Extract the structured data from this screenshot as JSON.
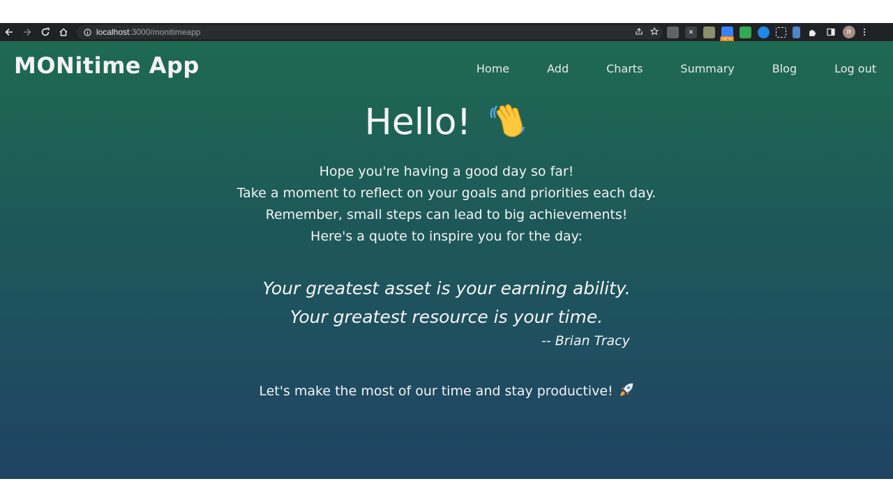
{
  "browser": {
    "url_host": "localhost",
    "url_rest": ":3000/monitimeapp",
    "extensions": [
      "printer-ext",
      "x-ext",
      "photo-ext",
      "calendar-ext",
      "sheet-ext",
      "edge-ext",
      "screenshot-ext",
      "clipboard-ext",
      "puzzle-ext",
      "sidepanel-ext"
    ],
    "new_badge": "NEW",
    "avatar_initial": "R"
  },
  "app": {
    "brand": "MONitime App",
    "nav": [
      "Home",
      "Add",
      "Charts",
      "Summary",
      "Blog",
      "Log out"
    ],
    "greeting": "Hello!",
    "messages": [
      "Hope you're having a good day so far!",
      "Take a moment to reflect on your goals and priorities each day.",
      "Remember, small steps can lead to big achievements!",
      "Here's a quote to inspire you for the day:"
    ],
    "quote_lines": [
      "Your greatest asset is your earning ability.",
      "Your greatest resource is your time."
    ],
    "author": "-- Brian Tracy",
    "closing": "Let's make the most of our time and stay productive!",
    "colors": {
      "gradient_top": "#1e6a52",
      "gradient_bottom": "#1f4262"
    }
  }
}
